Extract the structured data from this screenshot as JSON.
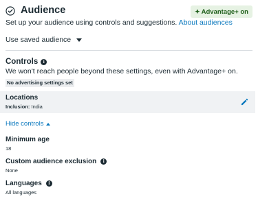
{
  "header": {
    "title": "Audience",
    "badge": "Advantage+ on",
    "icon": "check-circle-icon",
    "badge_icon": "sparkle-icon",
    "accent_color": "#0a78be",
    "badge_bg": "#e6f2e3",
    "badge_text_color": "#1e5e1a"
  },
  "subtitle": {
    "text": "Set up your audience using controls and suggestions.",
    "link": "About audiences"
  },
  "saved_audience": {
    "label": "Use saved audience"
  },
  "controls": {
    "title": "Controls",
    "description": "We won't reach people beyond these settings, even with Advantage+ on.",
    "status": "No advertising settings set"
  },
  "locations": {
    "title": "Locations",
    "sub_label": "Inclusion:",
    "sub_value": "India",
    "edit_icon": "pencil-icon"
  },
  "hide_controls": {
    "label": "Hide controls"
  },
  "fields": {
    "minimum_age": {
      "title": "Minimum age",
      "value": "18"
    },
    "custom_exclusion": {
      "title": "Custom audience exclusion",
      "value": "None"
    },
    "languages": {
      "title": "Languages",
      "value": "All languages"
    }
  }
}
